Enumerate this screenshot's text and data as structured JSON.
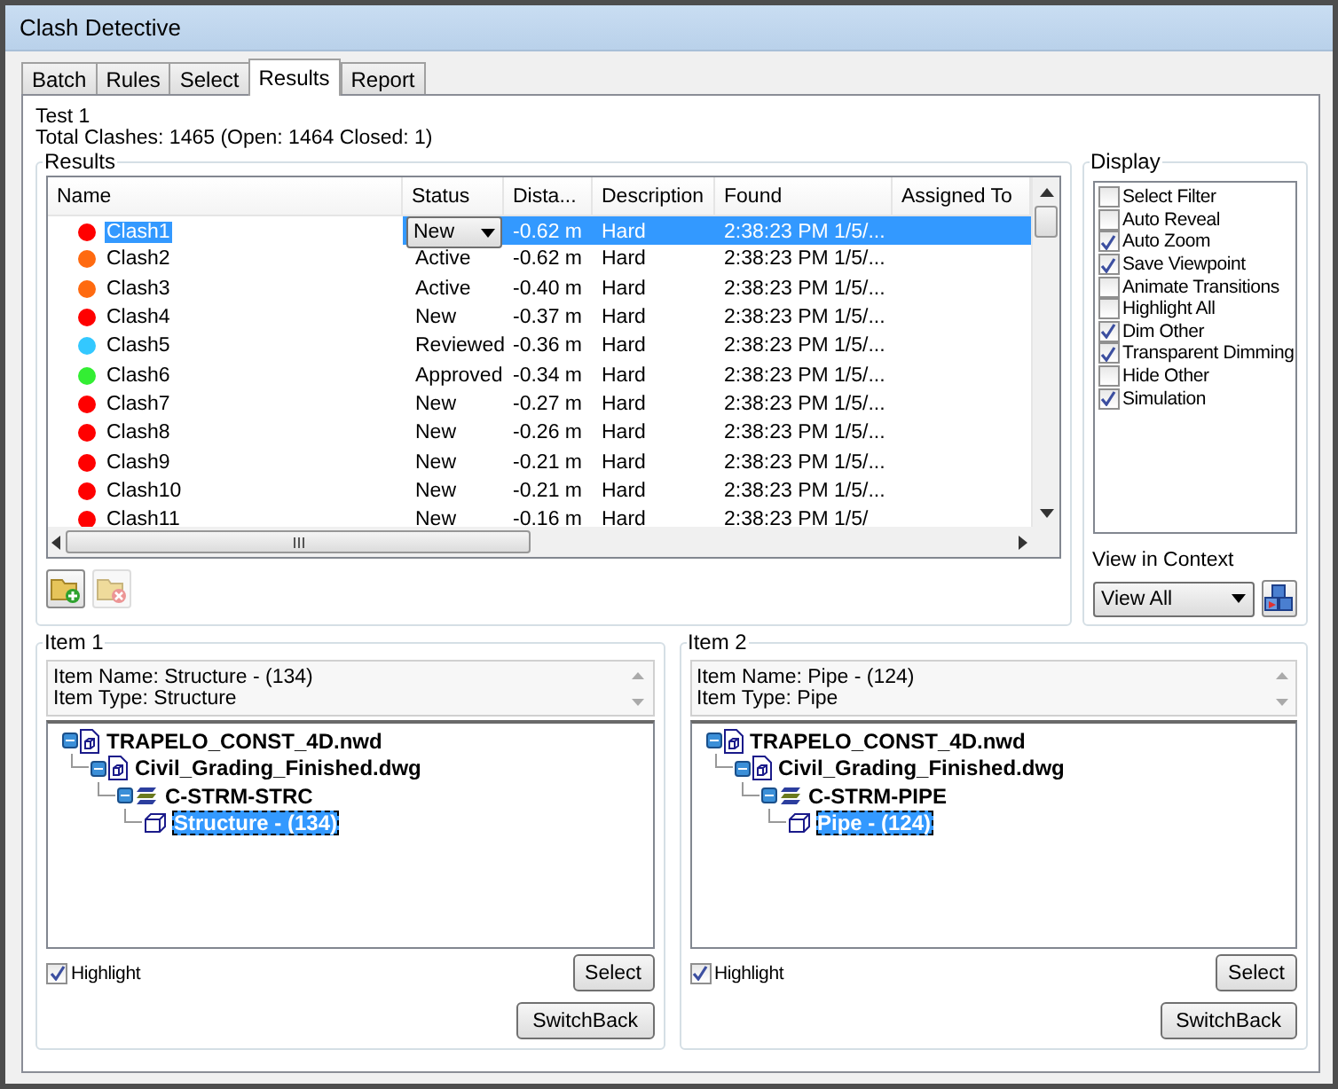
{
  "window": {
    "title": "Clash Detective"
  },
  "tabs": [
    {
      "label": "Batch",
      "selected": false
    },
    {
      "label": "Rules",
      "selected": false
    },
    {
      "label": "Select",
      "selected": false
    },
    {
      "label": "Results",
      "selected": true
    },
    {
      "label": "Report",
      "selected": false
    }
  ],
  "test_name": "Test 1",
  "summary": "Total Clashes: 1465 (Open: 1464 Closed: 1)",
  "results": {
    "title": "Results",
    "columns": [
      "Name",
      "Status",
      "Dista...",
      "Description",
      "Found",
      "Assigned To"
    ],
    "rows": [
      {
        "name": "Clash1",
        "color": "#ff0000",
        "status": "New",
        "distance": "-0.62 m",
        "description": "Hard",
        "found": "2:38:23 PM 1/5/...",
        "selected": true
      },
      {
        "name": "Clash2",
        "color": "#ff6a10",
        "status": "Active",
        "distance": "-0.62 m",
        "description": "Hard",
        "found": "2:38:23 PM 1/5/...",
        "selected": false
      },
      {
        "name": "Clash3",
        "color": "#ff6a10",
        "status": "Active",
        "distance": "-0.40 m",
        "description": "Hard",
        "found": "2:38:23 PM 1/5/...",
        "selected": false
      },
      {
        "name": "Clash4",
        "color": "#ff0000",
        "status": "New",
        "distance": "-0.37 m",
        "description": "Hard",
        "found": "2:38:23 PM 1/5/...",
        "selected": false
      },
      {
        "name": "Clash5",
        "color": "#33c8ff",
        "status": "Reviewed",
        "distance": "-0.36 m",
        "description": "Hard",
        "found": "2:38:23 PM 1/5/...",
        "selected": false
      },
      {
        "name": "Clash6",
        "color": "#33ee33",
        "status": "Approved",
        "distance": "-0.34 m",
        "description": "Hard",
        "found": "2:38:23 PM 1/5/...",
        "selected": false
      },
      {
        "name": "Clash7",
        "color": "#ff0000",
        "status": "New",
        "distance": "-0.27 m",
        "description": "Hard",
        "found": "2:38:23 PM 1/5/...",
        "selected": false
      },
      {
        "name": "Clash8",
        "color": "#ff0000",
        "status": "New",
        "distance": "-0.26 m",
        "description": "Hard",
        "found": "2:38:23 PM 1/5/...",
        "selected": false
      },
      {
        "name": "Clash9",
        "color": "#ff0000",
        "status": "New",
        "distance": "-0.21 m",
        "description": "Hard",
        "found": "2:38:23 PM 1/5/...",
        "selected": false
      },
      {
        "name": "Clash10",
        "color": "#ff0000",
        "status": "New",
        "distance": "-0.21 m",
        "description": "Hard",
        "found": "2:38:23 PM 1/5/...",
        "selected": false
      },
      {
        "name": "Clash11",
        "color": "#ff0000",
        "status": "New",
        "distance": "-0.16 m",
        "description": "Hard",
        "found": "2:38:23 PM 1/5/",
        "selected": false
      }
    ],
    "toolbar": [
      {
        "kind": "add",
        "disabled": false
      },
      {
        "kind": "remove",
        "disabled": true
      }
    ]
  },
  "display": {
    "title": "Display",
    "options": [
      {
        "label": "Select Filter",
        "checked": false
      },
      {
        "label": "Auto Reveal",
        "checked": false
      },
      {
        "label": "Auto Zoom",
        "checked": true
      },
      {
        "label": "Save Viewpoint",
        "checked": true
      },
      {
        "label": "Animate Transitions",
        "checked": false
      },
      {
        "label": "Highlight All",
        "checked": false
      },
      {
        "label": "Dim Other",
        "checked": true
      },
      {
        "label": "Transparent Dimming",
        "checked": true
      },
      {
        "label": "Hide Other",
        "checked": false
      },
      {
        "label": "Simulation",
        "checked": true
      }
    ],
    "context_label": "View in Context",
    "context_value": "View All"
  },
  "items": [
    {
      "title": "Item 1",
      "info": [
        "Item Name: Structure - (134)",
        "Item Type: Structure"
      ],
      "tree": [
        {
          "label": "TRAPELO_CONST_4D.nwd",
          "kind": "file",
          "expanded": true,
          "selected": false,
          "children": [
            {
              "label": "Civil_Grading_Finished.dwg",
              "kind": "file",
              "expanded": true,
              "selected": false,
              "children": [
                {
                  "label": "C-STRM-STRC",
                  "kind": "layer",
                  "expanded": true,
                  "selected": false,
                  "children": [
                    {
                      "label": "Structure - (134)",
                      "kind": "geometry",
                      "selected": true
                    }
                  ]
                }
              ]
            }
          ]
        }
      ],
      "highlight": {
        "label": "Highlight",
        "checked": true
      },
      "select_button": "Select",
      "switch_button": "SwitchBack"
    },
    {
      "title": "Item 2",
      "info": [
        "Item Name: Pipe - (124)",
        "Item Type: Pipe"
      ],
      "tree": [
        {
          "label": "TRAPELO_CONST_4D.nwd",
          "kind": "file",
          "expanded": true,
          "selected": false,
          "children": [
            {
              "label": "Civil_Grading_Finished.dwg",
              "kind": "file",
              "expanded": true,
              "selected": false,
              "children": [
                {
                  "label": "C-STRM-PIPE",
                  "kind": "layer",
                  "expanded": true,
                  "selected": false,
                  "children": [
                    {
                      "label": "Pipe - (124)",
                      "kind": "geometry",
                      "selected": true
                    }
                  ]
                }
              ]
            }
          ]
        }
      ],
      "highlight": {
        "label": "Highlight",
        "checked": true
      },
      "select_button": "Select",
      "switch_button": "SwitchBack"
    }
  ]
}
